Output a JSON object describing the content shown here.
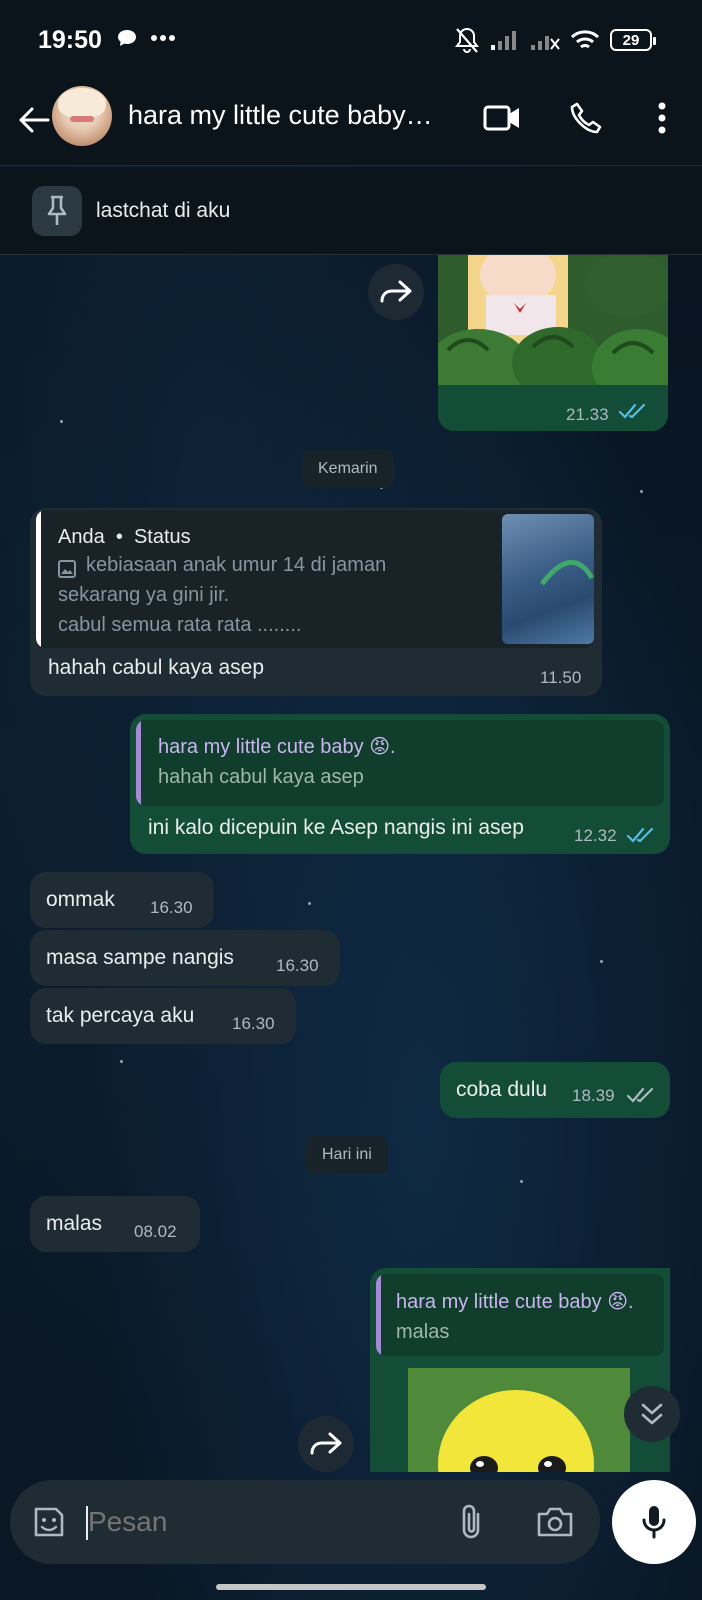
{
  "status_bar": {
    "time": "19:50",
    "battery": "29"
  },
  "header": {
    "title": "hara my little cute baby…",
    "back_icon": "arrow-left-icon",
    "video_icon": "video-call-icon",
    "call_icon": "phone-icon",
    "menu_icon": "more-vert-icon"
  },
  "pinned": {
    "text": "lastchat di aku",
    "icon": "pin-icon"
  },
  "messages": {
    "m1": {
      "time": "21.33",
      "ticks": "read",
      "type": "image"
    },
    "date1": "Kemarin",
    "m2": {
      "quote_author": "Anda",
      "quote_source": "Status",
      "quote_line1": "kebiasaan anak umur 14 di jaman",
      "quote_line2": "sekarang ya gini jir.",
      "quote_line3": "cabul semua rata rata ........",
      "text": "hahah cabul kaya asep",
      "time": "11.50"
    },
    "m3": {
      "quote_author": "hara my little cute baby 😡.",
      "quote_text": "hahah cabul kaya asep",
      "text": "ini kalo dicepuin ke Asep nangis ini asep",
      "time": "12.32",
      "ticks": "read"
    },
    "m4": {
      "text": "ommak",
      "time": "16.30"
    },
    "m5": {
      "text": "masa sampe nangis",
      "time": "16.30"
    },
    "m6": {
      "text": "tak percaya aku",
      "time": "16.30"
    },
    "m7": {
      "text": "coba dulu",
      "time": "18.39",
      "ticks": "delivered"
    },
    "date2": "Hari ini",
    "m8": {
      "text": "malas",
      "time": "08.02"
    },
    "m9": {
      "quote_author": "hara my little cute baby 😡.",
      "quote_text": "malas",
      "type": "image"
    }
  },
  "input": {
    "placeholder": "Pesan"
  },
  "colors": {
    "incoming": "#1f2c34",
    "outgoing": "#144d37",
    "read_ticks": "#53bdeb",
    "header_bg": "#0b141a"
  }
}
